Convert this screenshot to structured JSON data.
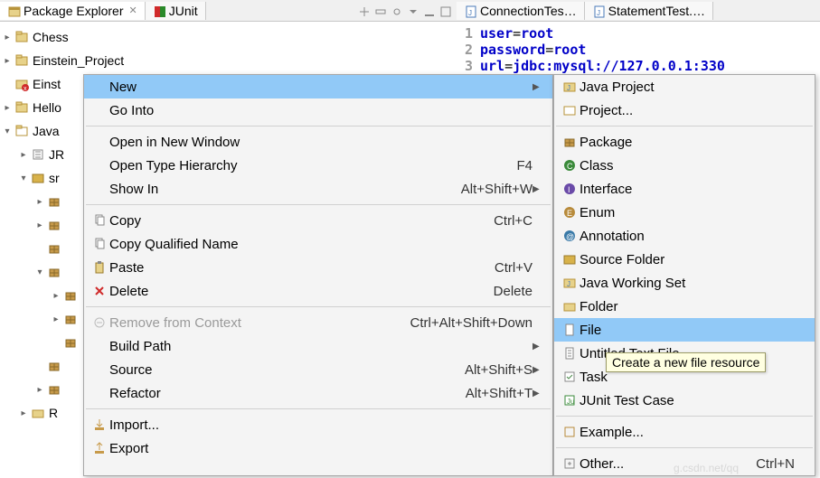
{
  "tabs_left": [
    {
      "label": "Package Explorer",
      "active": true,
      "icon": "package-explorer-icon"
    },
    {
      "label": "JUnit",
      "active": false,
      "icon": "junit-icon"
    }
  ],
  "tabs_right": [
    {
      "label": "ConnectionTes…",
      "icon": "java-file-icon"
    },
    {
      "label": "StatementTest.…",
      "icon": "java-file-icon"
    }
  ],
  "tree": [
    {
      "label": "Chess",
      "icon": "project-closed-icon",
      "twisty": ">",
      "indent": 0
    },
    {
      "label": "Einstein_Project",
      "icon": "project-closed-icon",
      "twisty": ">",
      "indent": 0
    },
    {
      "label": "Einst",
      "icon": "project-err-icon",
      "twisty": "",
      "indent": 0
    },
    {
      "label": "Hello",
      "icon": "project-closed-icon",
      "twisty": ">",
      "indent": 0
    },
    {
      "label": "Java",
      "icon": "project-open-icon",
      "twisty": "v",
      "indent": 0
    },
    {
      "label": "JR",
      "icon": "jar-lib-icon",
      "twisty": ">",
      "indent": 1
    },
    {
      "label": "sr",
      "icon": "src-folder-icon",
      "twisty": "v",
      "indent": 1
    },
    {
      "label": "",
      "icon": "package-icon",
      "twisty": ">",
      "indent": 2
    },
    {
      "label": "",
      "icon": "package-icon",
      "twisty": ">",
      "indent": 2
    },
    {
      "label": "",
      "icon": "package-icon",
      "twisty": "",
      "indent": 2
    },
    {
      "label": "",
      "icon": "package-icon",
      "twisty": "v",
      "indent": 2
    },
    {
      "label": "",
      "icon": "package-icon",
      "twisty": ">",
      "indent": 3
    },
    {
      "label": "",
      "icon": "package-icon",
      "twisty": ">",
      "indent": 3
    },
    {
      "label": "",
      "icon": "package-icon",
      "twisty": "",
      "indent": 3
    },
    {
      "label": "",
      "icon": "package-icon",
      "twisty": "",
      "indent": 2
    },
    {
      "label": "",
      "icon": "package-icon",
      "twisty": ">",
      "indent": 2
    },
    {
      "label": "R",
      "icon": "folder-icon",
      "twisty": ">",
      "indent": 1
    }
  ],
  "editor": {
    "lines": [
      {
        "n": "1",
        "key": "user",
        "val": "root"
      },
      {
        "n": "2",
        "key": "password",
        "val": "root"
      },
      {
        "n": "3",
        "key": "url",
        "val": "jdbc:mysql://127.0.0.1:330"
      }
    ]
  },
  "context_menu": [
    {
      "label": "New",
      "sel": true,
      "arrow": true
    },
    {
      "label": "Go Into"
    },
    {
      "sep": true
    },
    {
      "label": "Open in New Window"
    },
    {
      "label": "Open Type Hierarchy",
      "accel": "F4"
    },
    {
      "label": "Show In",
      "accel": "Alt+Shift+W",
      "arrow": true
    },
    {
      "sep": true
    },
    {
      "label": "Copy",
      "accel": "Ctrl+C",
      "icon": "copy-icon"
    },
    {
      "label": "Copy Qualified Name",
      "icon": "copy-qn-icon"
    },
    {
      "label": "Paste",
      "accel": "Ctrl+V",
      "icon": "paste-icon"
    },
    {
      "label": "Delete",
      "accel": "Delete",
      "icon": "delete-icon"
    },
    {
      "sep": true
    },
    {
      "label": "Remove from Context",
      "accel": "Ctrl+Alt+Shift+Down",
      "icon": "remove-context-icon",
      "disabled": true
    },
    {
      "label": "Build Path",
      "arrow": true
    },
    {
      "label": "Source",
      "accel": "Alt+Shift+S",
      "arrow": true
    },
    {
      "label": "Refactor",
      "accel": "Alt+Shift+T",
      "arrow": true
    },
    {
      "sep": true
    },
    {
      "label": "Import...",
      "icon": "import-icon"
    },
    {
      "label": "Export",
      "icon": "export-icon"
    }
  ],
  "new_submenu": [
    {
      "label": "Java Project",
      "icon": "java-project-icon"
    },
    {
      "label": "Project...",
      "icon": "project-icon"
    },
    {
      "sep": true
    },
    {
      "label": "Package",
      "icon": "package-icon"
    },
    {
      "label": "Class",
      "icon": "class-icon"
    },
    {
      "label": "Interface",
      "icon": "interface-icon"
    },
    {
      "label": "Enum",
      "icon": "enum-icon"
    },
    {
      "label": "Annotation",
      "icon": "annotation-icon"
    },
    {
      "label": "Source Folder",
      "icon": "source-folder-icon"
    },
    {
      "label": "Java Working Set",
      "icon": "working-set-icon"
    },
    {
      "label": "Folder",
      "icon": "folder-icon"
    },
    {
      "label": "File",
      "icon": "file-icon",
      "sel": true
    },
    {
      "label": "Untitled Text File",
      "icon": "text-file-icon"
    },
    {
      "label": "Task",
      "icon": "task-icon"
    },
    {
      "label": "JUnit Test Case",
      "icon": "junit-case-icon"
    },
    {
      "sep": true
    },
    {
      "label": "Example...",
      "icon": "example-icon"
    },
    {
      "sep": true
    },
    {
      "label": "Other...",
      "icon": "other-icon",
      "accel": "Ctrl+N"
    }
  ],
  "tooltip": "Create a new file resource",
  "watermark": "g.csdn.net/qq"
}
